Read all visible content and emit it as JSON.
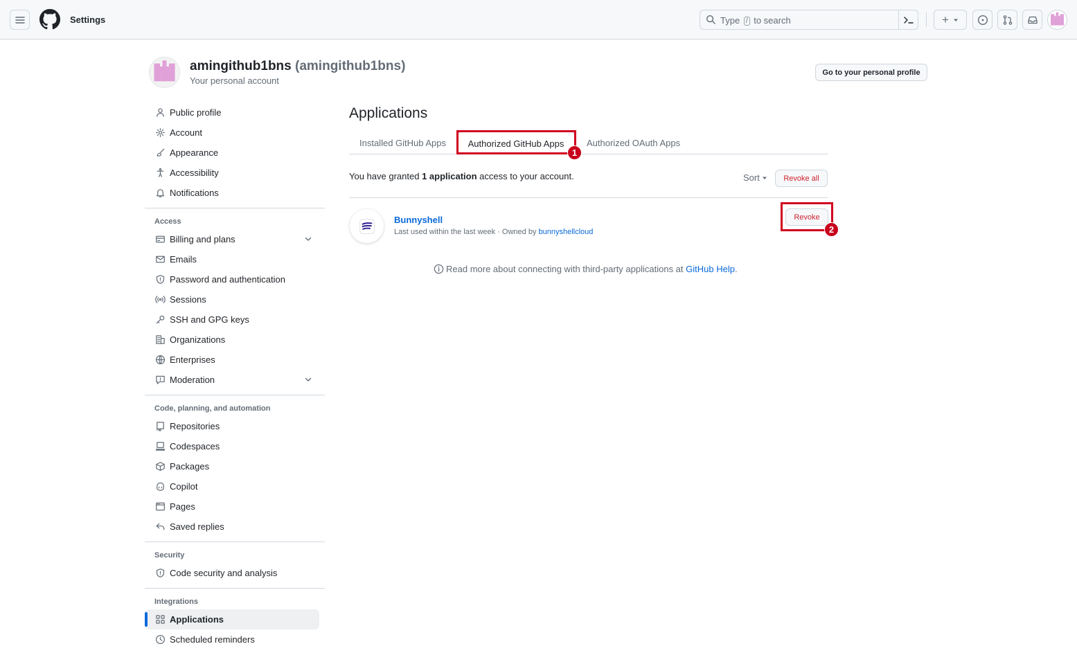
{
  "header": {
    "title": "Settings",
    "search_prefix": "Type",
    "search_slash": "/",
    "search_suffix": "to search",
    "plus": "+"
  },
  "account": {
    "name": "amingithub1bns",
    "login": "(amingithub1bns)",
    "subtitle": "Your personal account",
    "profile_button": "Go to your personal profile"
  },
  "sidebar": {
    "general": [
      {
        "label": "Public profile",
        "icon": "person-icon"
      },
      {
        "label": "Account",
        "icon": "gear-icon"
      },
      {
        "label": "Appearance",
        "icon": "paintbrush-icon"
      },
      {
        "label": "Accessibility",
        "icon": "accessibility-icon"
      },
      {
        "label": "Notifications",
        "icon": "bell-icon"
      }
    ],
    "access_heading": "Access",
    "access": [
      {
        "label": "Billing and plans",
        "icon": "credit-card-icon"
      },
      {
        "label": "Emails",
        "icon": "mail-icon"
      },
      {
        "label": "Password and authentication",
        "icon": "shield-icon"
      },
      {
        "label": "Sessions",
        "icon": "broadcast-icon"
      },
      {
        "label": "SSH and GPG keys",
        "icon": "key-icon"
      },
      {
        "label": "Organizations",
        "icon": "organization-icon"
      },
      {
        "label": "Enterprises",
        "icon": "globe-icon"
      },
      {
        "label": "Moderation",
        "icon": "report-icon"
      }
    ],
    "code_heading": "Code, planning, and automation",
    "code": [
      {
        "label": "Repositories",
        "icon": "repo-icon"
      },
      {
        "label": "Codespaces",
        "icon": "codespaces-icon"
      },
      {
        "label": "Packages",
        "icon": "package-icon"
      },
      {
        "label": "Copilot",
        "icon": "copilot-icon"
      },
      {
        "label": "Pages",
        "icon": "browser-icon"
      },
      {
        "label": "Saved replies",
        "icon": "reply-icon"
      }
    ],
    "security_heading": "Security",
    "security": [
      {
        "label": "Code security and analysis",
        "icon": "shield-icon"
      }
    ],
    "integrations_heading": "Integrations",
    "integrations": [
      {
        "label": "Applications",
        "icon": "apps-icon"
      },
      {
        "label": "Scheduled reminders",
        "icon": "clock-icon"
      }
    ]
  },
  "main": {
    "title": "Applications",
    "tabs": [
      {
        "label": "Installed GitHub Apps"
      },
      {
        "label": "Authorized GitHub Apps"
      },
      {
        "label": "Authorized OAuth Apps"
      }
    ],
    "granted_prefix": "You have granted ",
    "granted_bold": "1 application",
    "granted_suffix": " access to your account.",
    "sort_label": "Sort",
    "revoke_all_label": "Revoke all",
    "app": {
      "name": "Bunnyshell",
      "meta_prefix": "Last used within the last week · Owned by ",
      "owner": "bunnyshellcloud",
      "revoke_label": "Revoke"
    },
    "help_prefix": "Read more about connecting with third-party applications at ",
    "help_link": "GitHub Help",
    "help_suffix": "."
  },
  "annotations": {
    "badge1": "1",
    "badge2": "2",
    "color": "#d1001f"
  }
}
